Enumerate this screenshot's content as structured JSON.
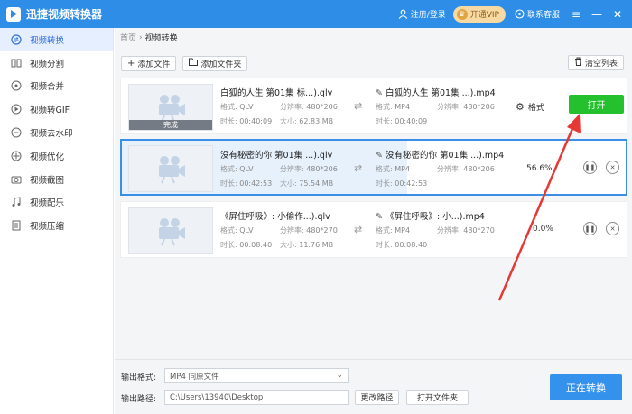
{
  "app": {
    "title": "迅捷视频转换器"
  },
  "titlebar": {
    "login": "注册/登录",
    "vip": "开通VIP",
    "support": "联系客服"
  },
  "sidebar": {
    "items": [
      {
        "label": "视频转换",
        "icon": "convert-icon",
        "active": true
      },
      {
        "label": "视频分割",
        "icon": "split-icon"
      },
      {
        "label": "视频合并",
        "icon": "merge-icon"
      },
      {
        "label": "视频转GIF",
        "icon": "gif-icon"
      },
      {
        "label": "视频去水印",
        "icon": "watermark-icon"
      },
      {
        "label": "视频优化",
        "icon": "optimize-icon"
      },
      {
        "label": "视频截图",
        "icon": "screenshot-icon"
      },
      {
        "label": "视频配乐",
        "icon": "music-icon"
      },
      {
        "label": "视频压缩",
        "icon": "compress-icon"
      }
    ]
  },
  "breadcrumb": {
    "home": "首页",
    "current": "视频转换"
  },
  "toolbar": {
    "add_file": "添加文件",
    "add_folder": "添加文件夹",
    "clear": "清空列表"
  },
  "labels": {
    "format": "格式:",
    "resolution": "分辨率:",
    "duration": "时长:",
    "size": "大小:",
    "format_btn": "格式",
    "open": "打开",
    "done": "完成"
  },
  "files": [
    {
      "src_name": "白狐的人生 第01集 标...).qlv",
      "src_format": "QLV",
      "src_res": "480*206",
      "src_dur": "00:40:09",
      "src_size": "62.83 MB",
      "dst_name": "白狐的人生 第01集 ...).mp4",
      "dst_format": "MP4",
      "dst_res": "480*206",
      "dst_dur": "00:40:09",
      "status": "完成"
    },
    {
      "src_name": "没有秘密的你 第01集 ...).qlv",
      "src_format": "QLV",
      "src_res": "480*206",
      "src_dur": "00:42:53",
      "src_size": "75.54 MB",
      "dst_name": "没有秘密的你 第01集 ...).mp4",
      "dst_format": "MP4",
      "dst_res": "480*206",
      "dst_dur": "00:42:53",
      "progress": "56.6%",
      "progress_value": 0.566
    },
    {
      "src_name": "《屏住呼吸》: 小偷作...).qlv",
      "src_format": "QLV",
      "src_res": "480*270",
      "src_dur": "00:08:40",
      "src_size": "11.76 MB",
      "dst_name": "《屏住呼吸》: 小...).mp4",
      "dst_format": "MP4",
      "dst_res": "480*270",
      "dst_dur": "00:08:40",
      "progress": "0.0%",
      "progress_value": 0.0
    }
  ],
  "bottom": {
    "output_format_label": "输出格式:",
    "output_format_value": "MP4  同原文件",
    "output_path_label": "输出路径:",
    "output_path_value": "C:\\Users\\13940\\Desktop",
    "change_path": "更改路径",
    "open_folder": "打开文件夹",
    "converting": "正在转换"
  },
  "colors": {
    "brand": "#2e8de6",
    "open_button": "#25c02d",
    "arrow": "#e53935"
  }
}
